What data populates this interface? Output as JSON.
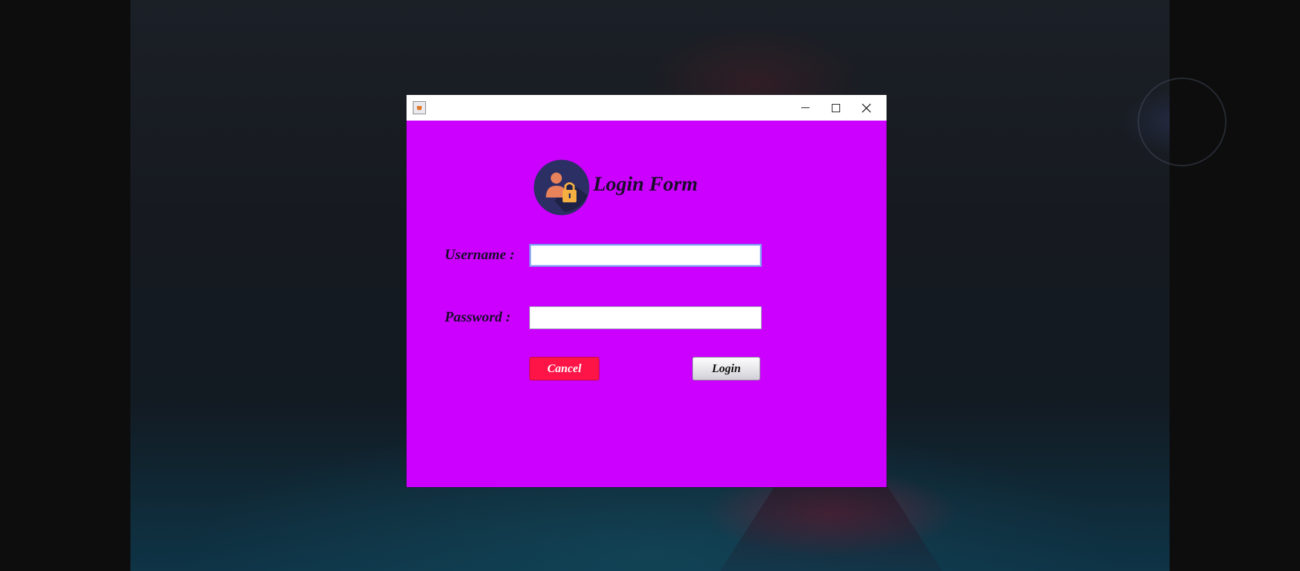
{
  "window": {
    "title": "",
    "controls": {
      "minimize": "minimize-icon",
      "maximize": "maximize-icon",
      "close": "close-icon"
    }
  },
  "form": {
    "logo_icon": "user-lock-icon",
    "title": "Login Form",
    "username_label": "Username :",
    "username_value": "",
    "password_label": "Password :",
    "password_value": "",
    "cancel_label": "Cancel",
    "login_label": "Login"
  },
  "colors": {
    "form_background": "#cc00ff",
    "cancel_button": "#ff1448",
    "login_button": "#e6e6ea",
    "titlebar": "#ffffff"
  }
}
